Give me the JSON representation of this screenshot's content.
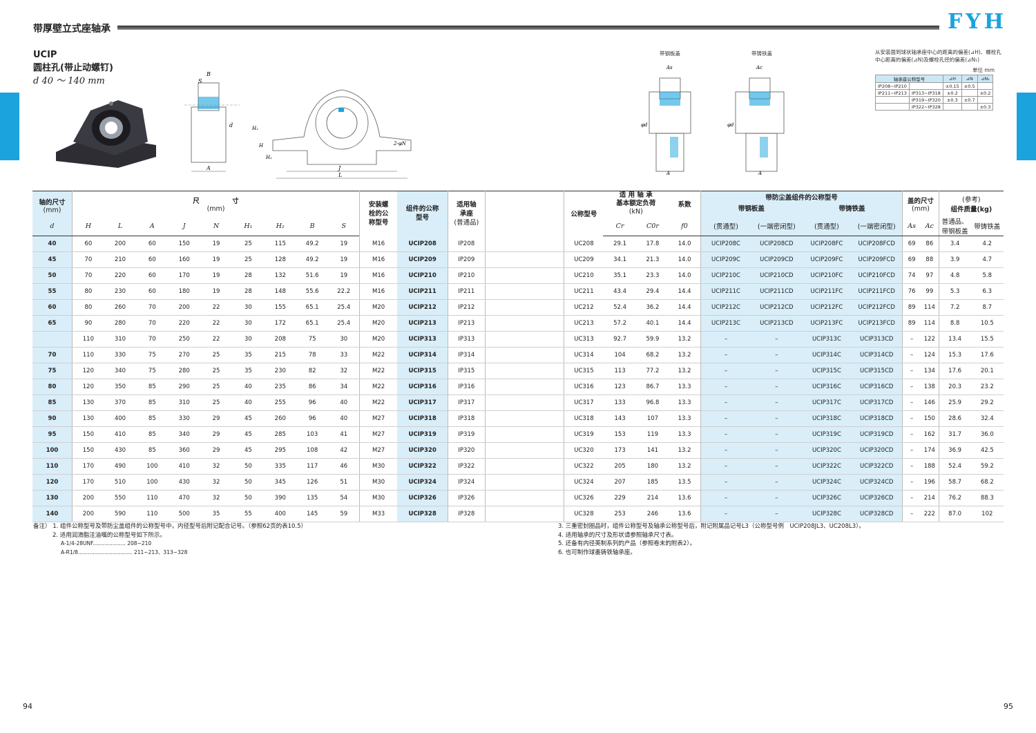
{
  "header": {
    "title": "带厚壁立式座轴承",
    "logo": "FYH",
    "side_label": "UCIP"
  },
  "model": {
    "code": "UCIP",
    "name": "圆柱孔(带止动螺钉)",
    "range": "d 40 ～ 140 mm"
  },
  "drawing_labels": {
    "steel": "带钢板盖",
    "cast": "带铸铁盖"
  },
  "tolerance": {
    "desc": "从安装面到球状轴承座中心的距离的偏差(⊿H)、螺栓孔中心距离的偏差(⊿N)及螺栓孔径的偏差(⊿N₁)",
    "unit": "单位 mm",
    "head": [
      "轴承座公称型号",
      "⊿H",
      "⊿N",
      "⊿N₁"
    ],
    "rows": [
      [
        "IP208~IP210",
        "",
        "±0.15",
        "±0.5",
        ""
      ],
      [
        "IP211~IP213",
        "IP313~IP318",
        "±0.2",
        "",
        "±0.2"
      ],
      [
        "",
        "IP319~IP320",
        "±0.3",
        "±0.7",
        ""
      ],
      [
        "",
        "IP322~IP328",
        "",
        "",
        "±0.3"
      ]
    ]
  },
  "table_head": {
    "shaft": "轴的尺寸",
    "shaft_unit": "(mm)",
    "dims": "尺　　　　　寸",
    "dims_unit": "(mm)",
    "cols": [
      "d",
      "H",
      "L",
      "A",
      "J",
      "N",
      "H₁",
      "H₂",
      "B",
      "S"
    ],
    "bolt": "安装螺栓的公称型号",
    "unit_no": "组件的公称型号",
    "housing": "适用轴承座",
    "housing_sub": "(普通品)",
    "bearing": "公称型号",
    "load_title": "适 用 轴 承",
    "load": "基本额定负荷",
    "load_unit": "(kN)",
    "cr": "Cr",
    "cor": "C0r",
    "coef": "系数",
    "f0": "f0",
    "cover": "带防尘盖组件的公称型号",
    "steel": "带钢板盖",
    "cast": "带铸铁盖",
    "through": "(贯通型)",
    "closed": "(一端密闭型)",
    "cover_size": "盖的尺寸",
    "cover_unit": "(mm)",
    "as": "As",
    "ac": "Ac",
    "mass": "(参考)",
    "mass2": "组件质量(kg)",
    "normal": "普通品、带钢板盖",
    "iron": "带铸铁盖"
  },
  "rows": [
    [
      "40",
      "60",
      "200",
      "60",
      "150",
      "19",
      "25",
      "115",
      "49.2",
      "19",
      "M16",
      "UCIP208",
      "IP208",
      "UC208",
      "29.1",
      "17.8",
      "14.0",
      "UCIP208C",
      "UCIP208CD",
      "UCIP208FC",
      "UCIP208FCD",
      "69",
      "86",
      "3.4",
      "4.2"
    ],
    [
      "45",
      "70",
      "210",
      "60",
      "160",
      "19",
      "25",
      "128",
      "49.2",
      "19",
      "M16",
      "UCIP209",
      "IP209",
      "UC209",
      "34.1",
      "21.3",
      "14.0",
      "UCIP209C",
      "UCIP209CD",
      "UCIP209FC",
      "UCIP209FCD",
      "69",
      "88",
      "3.9",
      "4.7"
    ],
    [
      "50",
      "70",
      "220",
      "60",
      "170",
      "19",
      "28",
      "132",
      "51.6",
      "19",
      "M16",
      "UCIP210",
      "IP210",
      "UC210",
      "35.1",
      "23.3",
      "14.0",
      "UCIP210C",
      "UCIP210CD",
      "UCIP210FC",
      "UCIP210FCD",
      "74",
      "97",
      "4.8",
      "5.8"
    ],
    [
      "55",
      "80",
      "230",
      "60",
      "180",
      "19",
      "28",
      "148",
      "55.6",
      "22.2",
      "M16",
      "UCIP211",
      "IP211",
      "UC211",
      "43.4",
      "29.4",
      "14.4",
      "UCIP211C",
      "UCIP211CD",
      "UCIP211FC",
      "UCIP211FCD",
      "76",
      "99",
      "5.3",
      "6.3"
    ],
    [
      "60",
      "80",
      "260",
      "70",
      "200",
      "22",
      "30",
      "155",
      "65.1",
      "25.4",
      "M20",
      "UCIP212",
      "IP212",
      "UC212",
      "52.4",
      "36.2",
      "14.4",
      "UCIP212C",
      "UCIP212CD",
      "UCIP212FC",
      "UCIP212FCD",
      "89",
      "114",
      "7.2",
      "8.7"
    ],
    [
      "65",
      "90",
      "280",
      "70",
      "220",
      "22",
      "30",
      "172",
      "65.1",
      "25.4",
      "M20",
      "UCIP213",
      "IP213",
      "UC213",
      "57.2",
      "40.1",
      "14.4",
      "UCIP213C",
      "UCIP213CD",
      "UCIP213FC",
      "UCIP213FCD",
      "89",
      "114",
      "8.8",
      "10.5"
    ],
    [
      "",
      "110",
      "310",
      "70",
      "250",
      "22",
      "30",
      "208",
      "75",
      "30",
      "M20",
      "UCIP313",
      "IP313",
      "UC313",
      "92.7",
      "59.9",
      "13.2",
      "–",
      "–",
      "UCIP313C",
      "UCIP313CD",
      "–",
      "122",
      "13.4",
      "15.5"
    ],
    [
      "70",
      "110",
      "330",
      "75",
      "270",
      "25",
      "35",
      "215",
      "78",
      "33",
      "M22",
      "UCIP314",
      "IP314",
      "UC314",
      "104",
      "68.2",
      "13.2",
      "–",
      "–",
      "UCIP314C",
      "UCIP314CD",
      "–",
      "124",
      "15.3",
      "17.6"
    ],
    [
      "75",
      "120",
      "340",
      "75",
      "280",
      "25",
      "35",
      "230",
      "82",
      "32",
      "M22",
      "UCIP315",
      "IP315",
      "UC315",
      "113",
      "77.2",
      "13.2",
      "–",
      "–",
      "UCIP315C",
      "UCIP315CD",
      "–",
      "134",
      "17.6",
      "20.1"
    ],
    [
      "80",
      "120",
      "350",
      "85",
      "290",
      "25",
      "40",
      "235",
      "86",
      "34",
      "M22",
      "UCIP316",
      "IP316",
      "UC316",
      "123",
      "86.7",
      "13.3",
      "–",
      "–",
      "UCIP316C",
      "UCIP316CD",
      "–",
      "138",
      "20.3",
      "23.2"
    ],
    [
      "85",
      "130",
      "370",
      "85",
      "310",
      "25",
      "40",
      "255",
      "96",
      "40",
      "M22",
      "UCIP317",
      "IP317",
      "UC317",
      "133",
      "96.8",
      "13.3",
      "–",
      "–",
      "UCIP317C",
      "UCIP317CD",
      "–",
      "146",
      "25.9",
      "29.2"
    ],
    [
      "90",
      "130",
      "400",
      "85",
      "330",
      "29",
      "45",
      "260",
      "96",
      "40",
      "M27",
      "UCIP318",
      "IP318",
      "UC318",
      "143",
      "107",
      "13.3",
      "–",
      "–",
      "UCIP318C",
      "UCIP318CD",
      "–",
      "150",
      "28.6",
      "32.4"
    ],
    [
      "95",
      "150",
      "410",
      "85",
      "340",
      "29",
      "45",
      "285",
      "103",
      "41",
      "M27",
      "UCIP319",
      "IP319",
      "UC319",
      "153",
      "119",
      "13.3",
      "–",
      "–",
      "UCIP319C",
      "UCIP319CD",
      "–",
      "162",
      "31.7",
      "36.0"
    ],
    [
      "100",
      "150",
      "430",
      "85",
      "360",
      "29",
      "45",
      "295",
      "108",
      "42",
      "M27",
      "UCIP320",
      "IP320",
      "UC320",
      "173",
      "141",
      "13.2",
      "–",
      "–",
      "UCIP320C",
      "UCIP320CD",
      "–",
      "174",
      "36.9",
      "42.5"
    ],
    [
      "110",
      "170",
      "490",
      "100",
      "410",
      "32",
      "50",
      "335",
      "117",
      "46",
      "M30",
      "UCIP322",
      "IP322",
      "UC322",
      "205",
      "180",
      "13.2",
      "–",
      "–",
      "UCIP322C",
      "UCIP322CD",
      "–",
      "188",
      "52.4",
      "59.2"
    ],
    [
      "120",
      "170",
      "510",
      "100",
      "430",
      "32",
      "50",
      "345",
      "126",
      "51",
      "M30",
      "UCIP324",
      "IP324",
      "UC324",
      "207",
      "185",
      "13.5",
      "–",
      "–",
      "UCIP324C",
      "UCIP324CD",
      "–",
      "196",
      "58.7",
      "68.2"
    ],
    [
      "130",
      "200",
      "550",
      "110",
      "470",
      "32",
      "50",
      "390",
      "135",
      "54",
      "M30",
      "UCIP326",
      "IP326",
      "UC326",
      "229",
      "214",
      "13.6",
      "–",
      "–",
      "UCIP326C",
      "UCIP326CD",
      "–",
      "214",
      "76.2",
      "88.3"
    ],
    [
      "140",
      "200",
      "590",
      "110",
      "500",
      "35",
      "55",
      "400",
      "145",
      "59",
      "M33",
      "UCIP328",
      "IP328",
      "UC328",
      "253",
      "246",
      "13.6",
      "–",
      "–",
      "UCIP328C",
      "UCIP328CD",
      "–",
      "222",
      "87.0",
      "102"
    ]
  ],
  "notes_left": [
    "备注） 1. 组件公称型号及带防尘盖组件的公称型号中，内径型号后附记配合记号。（参照62页的表10.5）",
    "2. 适用润滑脂注油嘴的公称型号如下所示。",
    "A-1/4-28UNF.................... 208~210",
    "A-R1/8................................. 211~213、313~328"
  ],
  "notes_right": [
    "3. 三重密封圈品时，组件公称型号及轴承公称型号后，附记附属品记号L3（公称型号例　UCIP208JL3、UC208L3）。",
    "4. 适用轴承的尺寸及形状请参照轴承尺寸表。",
    "5. 还备有内径英制系列的产品（参照卷末的附表2）。",
    "6. 也可制作球墨铸铁轴承座。"
  ],
  "page_left": "94",
  "page_right": "95"
}
